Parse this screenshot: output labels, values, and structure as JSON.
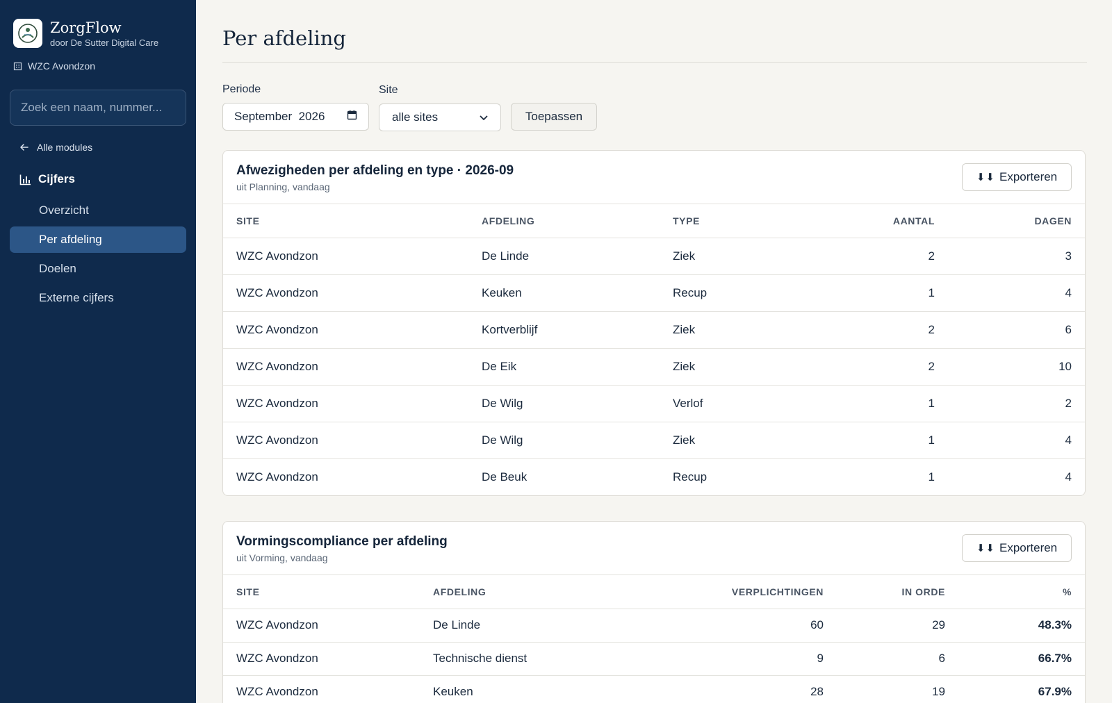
{
  "brand": {
    "name": "ZorgFlow",
    "subtitle": "door De Sutter Digital Care",
    "org": "WZC Avondzon"
  },
  "search": {
    "placeholder": "Zoek een naam, nummer..."
  },
  "nav": {
    "back_label": "Alle modules",
    "section_label": "Cijfers",
    "items": [
      {
        "label": "Overzicht",
        "active": false
      },
      {
        "label": "Per afdeling",
        "active": true
      },
      {
        "label": "Doelen",
        "active": false
      },
      {
        "label": "Externe cijfers",
        "active": false
      }
    ]
  },
  "page": {
    "title": "Per afdeling"
  },
  "filters": {
    "period_label": "Periode",
    "period_value": "September  2026",
    "site_label": "Site",
    "site_value": "alle sites",
    "apply_label": "Toepassen"
  },
  "absences": {
    "title": "Afwezigheden per afdeling en type · 2026-09",
    "subtitle": "uit Planning, vandaag",
    "export_label": "Exporteren",
    "columns": [
      "SITE",
      "AFDELING",
      "TYPE",
      "AANTAL",
      "DAGEN"
    ],
    "rows": [
      [
        "WZC Avondzon",
        "De Linde",
        "Ziek",
        "2",
        "3"
      ],
      [
        "WZC Avondzon",
        "Keuken",
        "Recup",
        "1",
        "4"
      ],
      [
        "WZC Avondzon",
        "Kortverblijf",
        "Ziek",
        "2",
        "6"
      ],
      [
        "WZC Avondzon",
        "De Eik",
        "Ziek",
        "2",
        "10"
      ],
      [
        "WZC Avondzon",
        "De Wilg",
        "Verlof",
        "1",
        "2"
      ],
      [
        "WZC Avondzon",
        "De Wilg",
        "Ziek",
        "1",
        "4"
      ],
      [
        "WZC Avondzon",
        "De Beuk",
        "Recup",
        "1",
        "4"
      ]
    ]
  },
  "training": {
    "title": "Vormingscompliance per afdeling",
    "subtitle": "uit Vorming, vandaag",
    "export_label": "Exporteren",
    "columns": [
      "SITE",
      "AFDELING",
      "VERPLICHTINGEN",
      "IN ORDE",
      "%"
    ],
    "rows": [
      [
        "WZC Avondzon",
        "De Linde",
        "60",
        "29",
        "48.3%"
      ],
      [
        "WZC Avondzon",
        "Technische dienst",
        "9",
        "6",
        "66.7%"
      ],
      [
        "WZC Avondzon",
        "Keuken",
        "28",
        "19",
        "67.9%"
      ]
    ]
  },
  "colors": {
    "sidebar": "#0f2a4c",
    "active_nav": "#2c5687",
    "background": "#f6f5f1"
  }
}
